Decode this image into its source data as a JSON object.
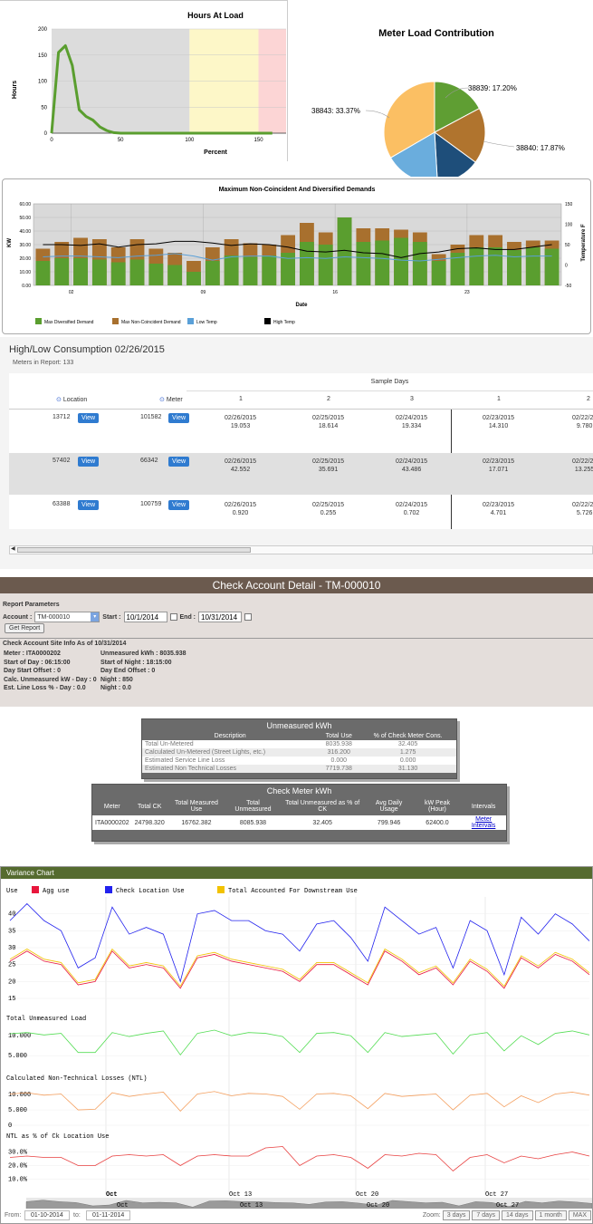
{
  "hours_at_load": {
    "title": "Hours At Load",
    "ylabel": "Hours",
    "xlabel": "Percent",
    "y_ticks": [
      "200",
      "150",
      "100",
      "50",
      "0"
    ],
    "x_ticks": [
      "0",
      "50",
      "100",
      "150"
    ],
    "chart_data": {
      "type": "line",
      "x": [
        0,
        5,
        10,
        15,
        20,
        25,
        30,
        35,
        40,
        45,
        50,
        60,
        80,
        100,
        120,
        140,
        160
      ],
      "values": [
        0,
        155,
        168,
        130,
        45,
        32,
        25,
        12,
        5,
        1,
        0,
        0,
        0,
        0,
        0,
        0,
        0
      ],
      "xlim": [
        0,
        170
      ],
      "ylim": [
        0,
        200
      ],
      "bands": [
        {
          "from": 0,
          "to": 100,
          "color": "#dcdcdc"
        },
        {
          "from": 100,
          "to": 150,
          "color": "#fdf7c8"
        },
        {
          "from": 150,
          "to": 170,
          "color": "#fcd5d5"
        }
      ],
      "line_color": "#5a9e2f"
    }
  },
  "meter_load": {
    "title": "Meter Load Contribution",
    "labels": [
      "38839: 17.20%",
      "38840: 17.87%",
      "38843: 33.37%"
    ],
    "chart_data": {
      "type": "pie",
      "slices": [
        {
          "name": "38839",
          "value": 17.2,
          "color": "#5f9e33"
        },
        {
          "name": "38840",
          "value": 17.87,
          "color": "#b0742e"
        },
        {
          "name": "",
          "value": 14.0,
          "color": "#1e4e7a"
        },
        {
          "name": "",
          "value": 17.56,
          "color": "#6aaddd"
        },
        {
          "name": "38843",
          "value": 33.37,
          "color": "#fbbf63"
        }
      ]
    }
  },
  "demand": {
    "title": "Maximum Non-Coincident And Diversified Demands",
    "ylabel": "KW",
    "y2label": "Temperature F",
    "xlabel": "Date",
    "y_ticks": [
      "60.00",
      "50.00",
      "40.00",
      "30.00",
      "20.00",
      "10.00",
      "0.00"
    ],
    "y2_ticks": [
      "150",
      "100",
      "50",
      "0",
      "-50"
    ],
    "x_ticks": [
      "02",
      "09",
      "16",
      "23"
    ],
    "legend": [
      "Max Diversified Demand",
      "Max Non-Coincident Demand",
      "Low Temp",
      "High Temp"
    ],
    "chart_data": {
      "type": "bar",
      "ylim": [
        0,
        60
      ],
      "y2lim": [
        -50,
        150
      ],
      "diversified": [
        18,
        20,
        20,
        19,
        17,
        19,
        16,
        15,
        10,
        18,
        22,
        21,
        22,
        24,
        32,
        30,
        50,
        32,
        33,
        35,
        32,
        18,
        24,
        28,
        28,
        26,
        28,
        27
      ],
      "non_coincident": [
        27,
        32,
        35,
        34,
        28,
        34,
        27,
        24,
        18,
        28,
        34,
        31,
        30,
        37,
        46,
        39,
        50,
        42,
        42,
        41,
        39,
        23,
        30,
        37,
        37,
        32,
        33,
        33
      ],
      "low_temp": [
        20,
        22,
        22,
        20,
        18,
        22,
        24,
        28,
        22,
        12,
        20,
        22,
        22,
        16,
        18,
        16,
        20,
        18,
        16,
        12,
        10,
        14,
        18,
        22,
        24,
        20,
        22,
        22
      ],
      "high_temp": [
        50,
        50,
        48,
        52,
        44,
        50,
        52,
        58,
        58,
        54,
        48,
        52,
        50,
        44,
        34,
        32,
        36,
        30,
        28,
        18,
        28,
        32,
        40,
        42,
        38,
        38,
        44,
        50
      ]
    }
  },
  "high_low": {
    "title": "High/Low Consumption 02/26/2015",
    "meters_in_report": "Meters in Report: 133",
    "sample_days": "Sample Days",
    "col_location": "Location",
    "col_meter": "Meter",
    "day_headers": [
      "1",
      "2",
      "3",
      "1",
      "2"
    ],
    "view_label": "View",
    "rows": [
      {
        "location": "13712",
        "meter": "101582",
        "cells": [
          [
            "02/26/2015",
            "19.053"
          ],
          [
            "02/25/2015",
            "18.614"
          ],
          [
            "02/24/2015",
            "19.334"
          ],
          [
            "02/23/2015",
            "14.310"
          ],
          [
            "02/22/20",
            "9.780"
          ]
        ]
      },
      {
        "location": "57402",
        "meter": "66342",
        "cells": [
          [
            "02/26/2015",
            "42.552"
          ],
          [
            "02/25/2015",
            "35.691"
          ],
          [
            "02/24/2015",
            "43.486"
          ],
          [
            "02/23/2015",
            "17.071"
          ],
          [
            "02/22/20",
            "13.255"
          ]
        ]
      },
      {
        "location": "63388",
        "meter": "100759",
        "cells": [
          [
            "02/26/2015",
            "0.920"
          ],
          [
            "02/25/2015",
            "0.255"
          ],
          [
            "02/24/2015",
            "0.702"
          ],
          [
            "02/23/2015",
            "4.701"
          ],
          [
            "02/22/20",
            "5.726"
          ]
        ]
      }
    ]
  },
  "check_account": {
    "title": "Check Account Detail - TM-000010",
    "report_params": "Report Parameters",
    "account_label": "Account :",
    "account_value": "TM-000010",
    "start_label": "Start :",
    "start_value": "10/1/2014",
    "end_label": "End :",
    "end_value": "10/31/2014",
    "get_report": "Get Report",
    "site_info_title": "Check Account Site Info As of 10/31/2014",
    "left_info": [
      "Meter : ITA0000202",
      "Start of Day : 06:15:00",
      "Day Start Offset : 0",
      "Calc. Unmeasured kW - Day : 0",
      "Est. Line Loss % - Day : 0.0"
    ],
    "right_info": [
      "Unmeasured kWh : 8035.938",
      "Start of Night : 18:15:00",
      "Day End Offset : 0",
      "Night : 850",
      "Night : 0.0"
    ]
  },
  "unmeasured": {
    "title": "Unmeasured kWh",
    "headers": [
      "Description",
      "Total Use",
      "% of Check Meter Cons."
    ],
    "rows": [
      [
        "Total Un-Metered",
        "8035.938",
        "32.405"
      ],
      [
        "Calculated Un-Metered (Street Lights, etc.)",
        "316.200",
        "1.275"
      ],
      [
        "Estimated Service Line Loss",
        "0.000",
        "0.000"
      ],
      [
        "Estimated Non Technical Losses",
        "7719.738",
        "31.130"
      ]
    ]
  },
  "check_meter": {
    "title": "Check Meter kWh",
    "headers": [
      "Meter",
      "Total CK",
      "Total Measured Use",
      "Total Unmeasured",
      "Total Unmeasured as % of CK",
      "Avg Daily Usage",
      "kW Peak (Hour)",
      "Intervals"
    ],
    "row": [
      "ITA0000202",
      "24798.320",
      "16762.382",
      "8085.938",
      "32.405",
      "799.946",
      "62400.0",
      "Meter Intervals"
    ]
  },
  "variance": {
    "title": "Variance Chart",
    "use_label": "Use",
    "legend": [
      "Agg use",
      "Check Location Use",
      "Total Accounted For Downstream Use"
    ],
    "legend_colors": [
      "#e8163c",
      "#2222ee",
      "#f2c200"
    ],
    "panel1_ticks": [
      "40",
      "35",
      "30",
      "25",
      "20",
      "15"
    ],
    "panel2_title": "Total Unmeasured Load",
    "panel2_ticks": [
      "10.000",
      "5.000"
    ],
    "panel3_title": "Calculated Non-Technical Losses (NTL)",
    "panel3_ticks": [
      "10.000",
      "5.000",
      "0"
    ],
    "panel4_title": "NTL as % of Ck Location Use",
    "panel4_ticks": [
      "30.0%",
      "20.0%",
      "10.0%"
    ],
    "x_ticks": [
      "Oct",
      "Oct 13",
      "Oct 20",
      "Oct 27"
    ],
    "nav_ticks": [
      "Oct",
      "Oct 13",
      "Oct 20",
      "Oct 27"
    ],
    "from_label": "From:",
    "from_value": "01-10-2014",
    "to_label": "to:",
    "to_value": "01-11-2014",
    "zoom_label": "Zoom:",
    "zoom_buttons": [
      "3 days",
      "7 days",
      "14 days",
      "1 month",
      "MAX"
    ],
    "chart_data": {
      "type": "line",
      "check_location": [
        38,
        43,
        38,
        35,
        24,
        27,
        42,
        34,
        36,
        34,
        20,
        40,
        41,
        38,
        38,
        35,
        34,
        29,
        37,
        38,
        33,
        26,
        42,
        38,
        34,
        36,
        24,
        38,
        35,
        22,
        39,
        34,
        40,
        37,
        32
      ],
      "agg_use": [
        26,
        29,
        26,
        25,
        19,
        20,
        29,
        24,
        25,
        24,
        18,
        27,
        28,
        26,
        25,
        24,
        23,
        20,
        25,
        25,
        22,
        19,
        29,
        26,
        22,
        24,
        19,
        26,
        23,
        18,
        27,
        24,
        28,
        26,
        22
      ],
      "unmeasured_load": [
        10.5,
        10.8,
        10.2,
        10.6,
        5.8,
        5.8,
        10.8,
        9.8,
        10.6,
        11.2,
        5.2,
        10.6,
        11.4,
        10.0,
        10.8,
        10.6,
        9.8,
        5.8,
        10.6,
        10.8,
        10.0,
        5.8,
        10.8,
        9.8,
        10.2,
        10.6,
        5.4,
        10.2,
        10.8,
        6.2,
        10.0,
        7.8,
        10.6,
        11.2,
        10.2
      ],
      "ntl": [
        10.2,
        10.6,
        9.8,
        10.2,
        5.0,
        5.2,
        10.6,
        9.4,
        10.2,
        10.8,
        4.6,
        10.2,
        11.0,
        9.6,
        10.4,
        10.2,
        9.4,
        5.2,
        10.2,
        10.4,
        9.6,
        5.4,
        10.4,
        9.4,
        9.8,
        10.2,
        5.0,
        9.8,
        10.4,
        6.0,
        9.6,
        7.4,
        10.2,
        10.8,
        9.8
      ],
      "ntl_pct": [
        26,
        27,
        26,
        26,
        20,
        20,
        27,
        28,
        27,
        28,
        20,
        27,
        28,
        27,
        27,
        33,
        34,
        20,
        27,
        28,
        26,
        18,
        28,
        27,
        29,
        28,
        16,
        26,
        28,
        22,
        27,
        25,
        28,
        30,
        27
      ]
    }
  }
}
